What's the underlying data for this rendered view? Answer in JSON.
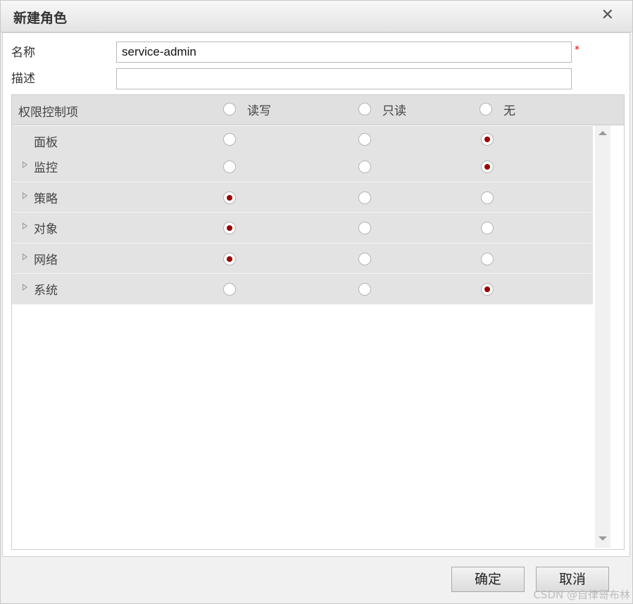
{
  "dialog": {
    "title": "新建角色",
    "close_icon": "close-icon"
  },
  "form": {
    "name_label": "名称",
    "name_value": "service-admin",
    "required_mark": "*",
    "desc_label": "描述",
    "desc_value": ""
  },
  "permissions": {
    "header": {
      "label": "权限控制项",
      "read_write": "读写",
      "read_only": "只读",
      "none": "无"
    },
    "rows": [
      {
        "label": "面板",
        "expandable": false,
        "selected": "none"
      },
      {
        "label": "监控",
        "expandable": true,
        "selected": "none"
      },
      {
        "label": "策略",
        "expandable": true,
        "selected": "read_write"
      },
      {
        "label": "对象",
        "expandable": true,
        "selected": "read_write"
      },
      {
        "label": "网络",
        "expandable": true,
        "selected": "read_write"
      },
      {
        "label": "系统",
        "expandable": true,
        "selected": "none"
      }
    ],
    "selected_color": "#9b0000"
  },
  "footer": {
    "ok": "确定",
    "cancel": "取消"
  },
  "watermark": "CSDN @自律哥布林"
}
